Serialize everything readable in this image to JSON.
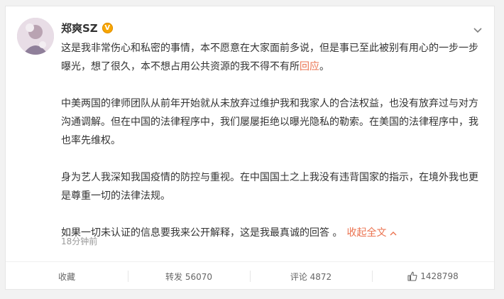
{
  "post": {
    "author": "郑爽SZ",
    "vip_badge": "V",
    "paragraphs": [
      {
        "text": "这是我非常伤心和私密的事情，本不愿意在大家面前多说，但是事已至此被别有用心的一步一步曝光，想了很久，本不想占用公共资源的我不得不有所",
        "highlight": "回应",
        "tail": "。"
      },
      {
        "text": "中美两国的律师团队从前年开始就从未放弃过维护我和我家人的合法权益，也没有放弃过与对方沟通调解。但在中国的法律程序中，我们屡屡拒绝以曝光隐私的勒索。在美国的法律程序中，我也率先维权。"
      },
      {
        "text": "身为艺人我深知我国疫情的防控与重视。在中国国土之上我没有违背国家的指示，在境外我也更是尊重一切的法律法规。"
      },
      {
        "text": "如果一切未认证的信息要我来公开解释，这是我最真诚的回答 。"
      }
    ],
    "collapse_label": "收起全文",
    "time": "18分钟前"
  },
  "actions": {
    "favorite": "收藏",
    "repost": "转发 56070",
    "comment": "评论 4872",
    "like": "1428798"
  },
  "colors": {
    "accent": "#eb7350",
    "vip": "#f7a600"
  }
}
